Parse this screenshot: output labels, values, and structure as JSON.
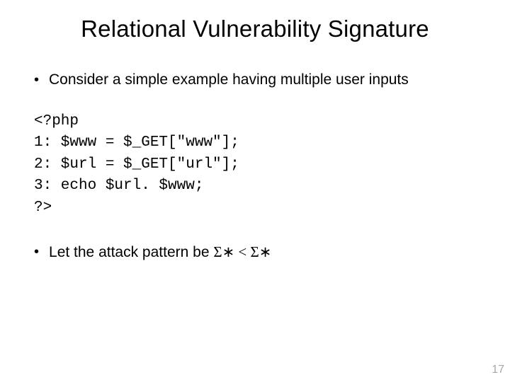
{
  "title": "Relational Vulnerability Signature",
  "bullet1": "Consider a simple example having multiple user inputs",
  "code": {
    "l0": "<?php",
    "l1": "1: $www = $_GET[\"www\"];",
    "l2": "2: $url = $_GET[\"url\"];",
    "l3": "3: echo $url. $www;",
    "l4": "?>"
  },
  "bullet2_prefix": "Let the attack pattern be  ",
  "bullet2_expr": "Σ∗ < Σ∗",
  "page_number": "17"
}
